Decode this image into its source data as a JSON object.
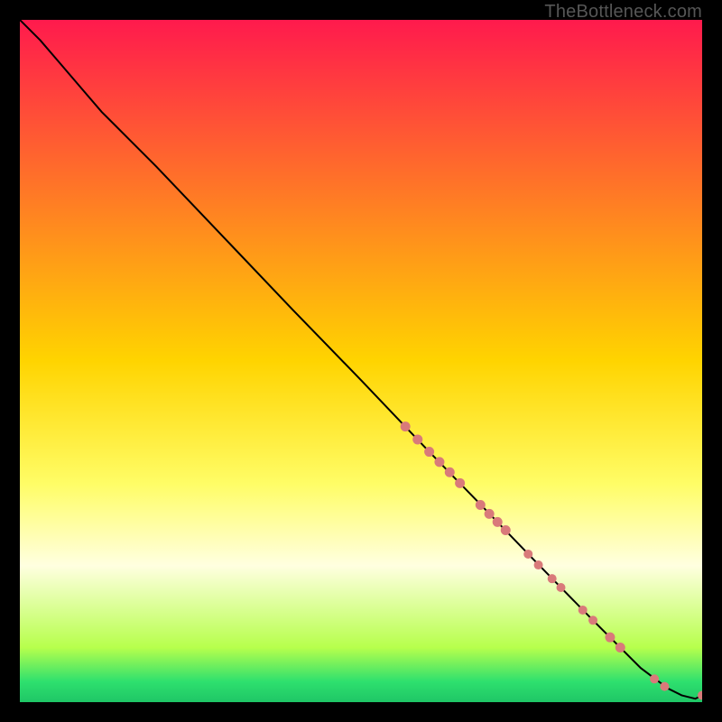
{
  "attribution": "TheBottleneck.com",
  "chart_data": {
    "type": "line",
    "title": "",
    "xlabel": "",
    "ylabel": "",
    "xlim": [
      0,
      100
    ],
    "ylim": [
      0,
      100
    ],
    "grid": false,
    "background_gradient": [
      {
        "stop": 0.0,
        "color": "#ff1a4d"
      },
      {
        "stop": 0.5,
        "color": "#ffd400"
      },
      {
        "stop": 0.68,
        "color": "#fffd66"
      },
      {
        "stop": 0.8,
        "color": "#ffffe0"
      },
      {
        "stop": 0.92,
        "color": "#b7ff4c"
      },
      {
        "stop": 0.97,
        "color": "#2ee06e"
      },
      {
        "stop": 1.0,
        "color": "#1fc666"
      }
    ],
    "series": [
      {
        "name": "curve",
        "x": [
          0,
          3,
          6,
          9,
          12,
          16,
          20,
          30,
          40,
          50,
          60,
          67,
          75,
          84,
          91,
          95,
          97,
          99,
          100
        ],
        "y": [
          100,
          97,
          93.5,
          90,
          86.5,
          82.5,
          78.5,
          68,
          57.5,
          47.2,
          36.7,
          29.5,
          21.2,
          12.0,
          5.0,
          2.0,
          1.0,
          0.5,
          1.0
        ]
      }
    ],
    "points": {
      "name": "markers",
      "color": "#d97a7a",
      "data": [
        {
          "x": 56.5,
          "y": 40.4,
          "r": 5.5
        },
        {
          "x": 58.3,
          "y": 38.5,
          "r": 5.5
        },
        {
          "x": 60.0,
          "y": 36.7,
          "r": 5.5
        },
        {
          "x": 61.5,
          "y": 35.2,
          "r": 5.5
        },
        {
          "x": 63.0,
          "y": 33.7,
          "r": 5.5
        },
        {
          "x": 64.5,
          "y": 32.1,
          "r": 5.5
        },
        {
          "x": 67.5,
          "y": 28.9,
          "r": 5.5
        },
        {
          "x": 68.8,
          "y": 27.6,
          "r": 5.5
        },
        {
          "x": 70.0,
          "y": 26.4,
          "r": 5.5
        },
        {
          "x": 71.2,
          "y": 25.2,
          "r": 5.5
        },
        {
          "x": 74.5,
          "y": 21.7,
          "r": 5.0
        },
        {
          "x": 76.0,
          "y": 20.1,
          "r": 5.0
        },
        {
          "x": 78.0,
          "y": 18.1,
          "r": 5.0
        },
        {
          "x": 79.3,
          "y": 16.8,
          "r": 5.0
        },
        {
          "x": 82.5,
          "y": 13.5,
          "r": 5.0
        },
        {
          "x": 84.0,
          "y": 12.0,
          "r": 5.0
        },
        {
          "x": 86.5,
          "y": 9.5,
          "r": 5.5
        },
        {
          "x": 88.0,
          "y": 8.0,
          "r": 5.5
        },
        {
          "x": 93.0,
          "y": 3.4,
          "r": 5.0
        },
        {
          "x": 94.5,
          "y": 2.3,
          "r": 5.0
        },
        {
          "x": 100.0,
          "y": 1.0,
          "r": 5.0
        }
      ]
    }
  }
}
